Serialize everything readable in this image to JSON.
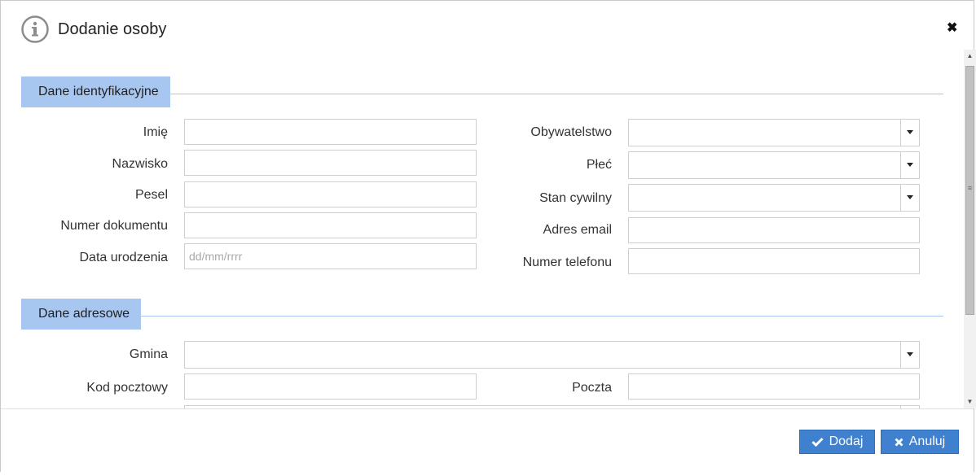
{
  "dialog": {
    "title": "Dodanie osoby",
    "close_symbol": "✖"
  },
  "sections": {
    "identification": {
      "title": "Dane identyfikacyjne",
      "fields": {
        "first_name": {
          "label": "Imię",
          "value": ""
        },
        "last_name": {
          "label": "Nazwisko",
          "value": ""
        },
        "pesel": {
          "label": "Pesel",
          "value": ""
        },
        "document_number": {
          "label": "Numer dokumentu",
          "value": ""
        },
        "birth_date": {
          "label": "Data urodzenia",
          "value": "",
          "placeholder": "dd/mm/rrrr"
        },
        "citizenship": {
          "label": "Obywatelstwo",
          "value": ""
        },
        "gender": {
          "label": "Płeć",
          "value": ""
        },
        "marital_status": {
          "label": "Stan cywilny",
          "value": ""
        },
        "email": {
          "label": "Adres email",
          "value": ""
        },
        "phone": {
          "label": "Numer telefonu",
          "value": ""
        }
      }
    },
    "address": {
      "title": "Dane adresowe",
      "fields": {
        "municipality": {
          "label": "Gmina",
          "value": ""
        },
        "postal_code": {
          "label": "Kod pocztowy",
          "value": ""
        },
        "post_office": {
          "label": "Poczta",
          "value": ""
        }
      }
    }
  },
  "footer": {
    "add_label": "Dodaj",
    "cancel_label": "Anuluj"
  },
  "icons": {
    "info": "info-circle-icon",
    "close": "close-icon",
    "add": "check-icon",
    "cancel": "x-icon"
  },
  "colors": {
    "section_header_bg": "#a7c7f1",
    "primary_button": "#3f80cf"
  }
}
